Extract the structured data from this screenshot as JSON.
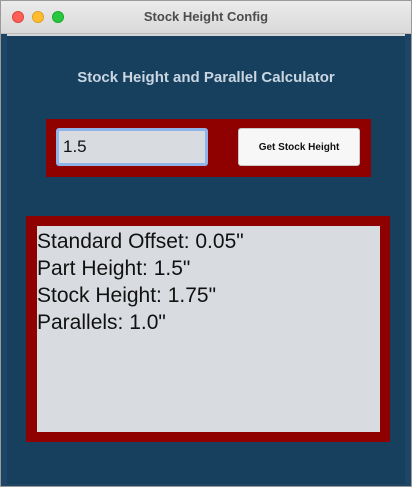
{
  "window": {
    "title": "Stock Height Config"
  },
  "main": {
    "heading": "Stock Height and Parallel Calculator",
    "part_height_input": {
      "value": "1.5",
      "placeholder": ""
    },
    "get_button_label": "Get Stock Height",
    "output_lines": [
      "Standard Offset: 0.05\"",
      "Part Height: 1.5\"",
      "Stock Height: 1.75\"",
      "Parallels: 1.0\""
    ]
  },
  "colors": {
    "background": "#17405f",
    "panel": "#8f0000",
    "text_area": "#d8dbe0",
    "heading_text": "#c9d6e2",
    "input_focus": "#8fb4ea"
  },
  "icons": {
    "close": "traffic-light-close-icon",
    "minimize": "traffic-light-minimize-icon",
    "maximize": "traffic-light-maximize-icon"
  }
}
